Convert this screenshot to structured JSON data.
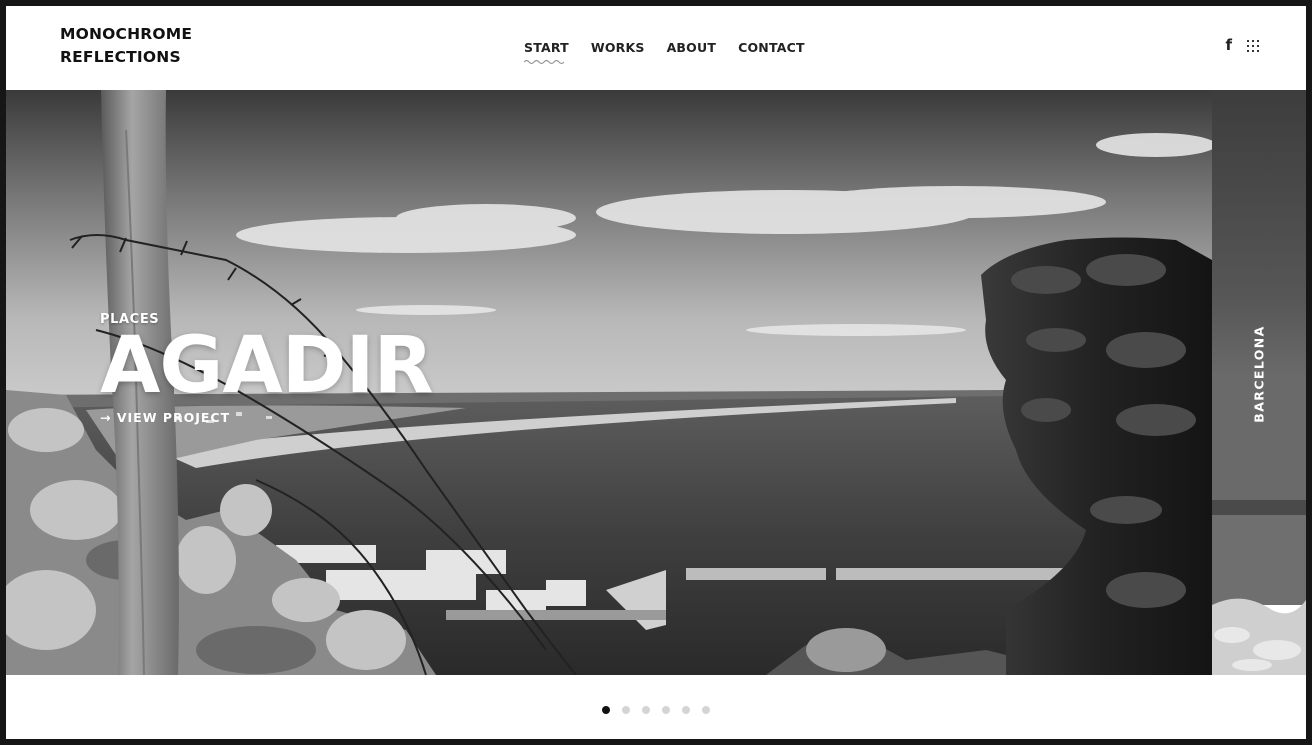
{
  "header": {
    "logo_line1": "MONOCHROME",
    "logo_line2": "REFLECTIONS",
    "nav": [
      {
        "label": "START",
        "active": true
      },
      {
        "label": "WORKS",
        "active": false
      },
      {
        "label": "ABOUT",
        "active": false
      },
      {
        "label": "CONTACT",
        "active": false
      }
    ],
    "social": {
      "facebook_glyph": "f",
      "facebook_icon": "facebook-icon",
      "grid_icon": "grid-dots-icon"
    }
  },
  "hero": {
    "category": "PLACES",
    "title": "AGADIR",
    "cta_label": "→ VIEW PROJECT",
    "image": "black-and-white coastal city view with harbor, bay and rocks"
  },
  "next_slide": {
    "label": "BARCELONA"
  },
  "pagination": {
    "total": 6,
    "active_index": 0
  },
  "colors": {
    "frame": "#161616",
    "text": "#111111",
    "dot_active": "#111111",
    "dot_inactive": "#d4d4d4"
  }
}
